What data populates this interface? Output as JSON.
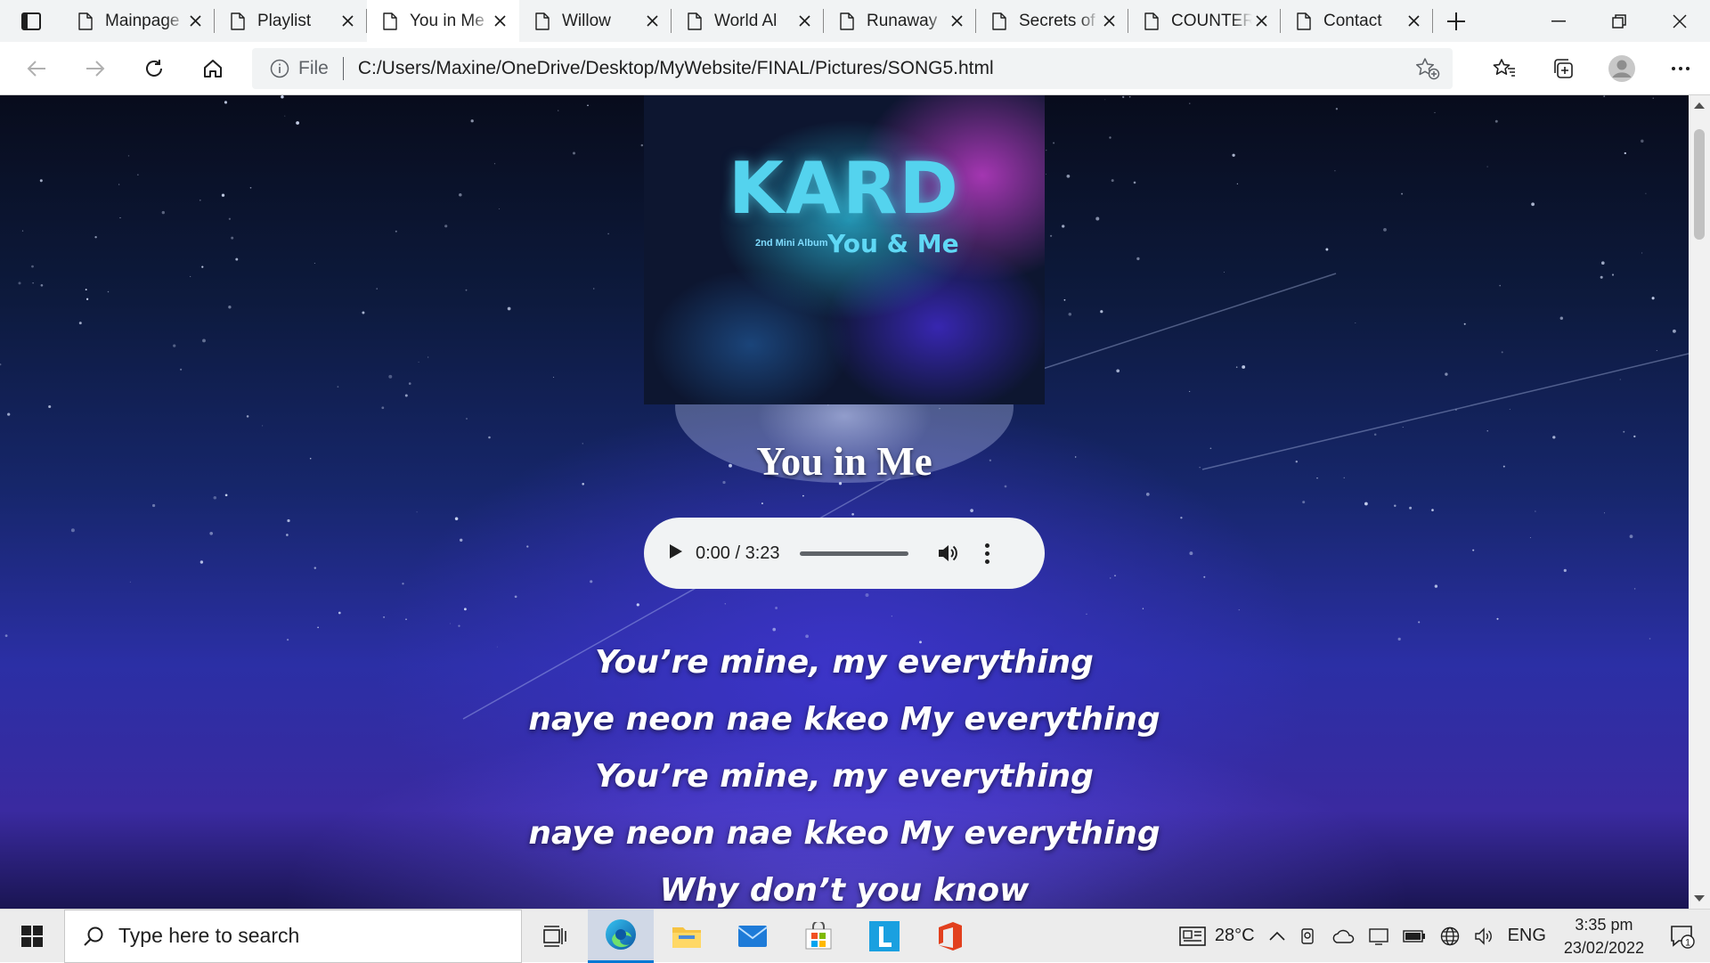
{
  "browser": {
    "tabs": [
      {
        "title": "Mainpage",
        "active": false
      },
      {
        "title": "Playlist",
        "active": false
      },
      {
        "title": "You in Me",
        "active": true
      },
      {
        "title": "Willow",
        "active": false
      },
      {
        "title": "World Al",
        "active": false
      },
      {
        "title": "Runaway",
        "active": false
      },
      {
        "title": "Secrets of",
        "active": false
      },
      {
        "title": "COUNTER",
        "active": false
      },
      {
        "title": "Contact",
        "active": false
      }
    ],
    "address": {
      "file_label": "File",
      "url": "C:/Users/Maxine/OneDrive/Desktop/MyWebsite/FINAL/Pictures/SONG5.html"
    }
  },
  "page": {
    "album": {
      "logo": "KARD",
      "subtitle": "2nd Mini Album",
      "album_title": "You & Me"
    },
    "song_title": "You in Me",
    "player": {
      "time": "0:00 / 3:23",
      "progress": 0
    },
    "lyrics": [
      "You’re mine, my everything",
      "naye neon nae kkeo My everything",
      "You’re mine, my everything",
      "naye neon nae kkeo My everything",
      "Why don’t you know"
    ]
  },
  "taskbar": {
    "search_placeholder": "Type here to search",
    "apps": [
      "edge-icon",
      "file-explorer-icon",
      "mail-icon",
      "store-icon",
      "l-app-icon",
      "office-icon"
    ],
    "tray": {
      "weather": "28°C",
      "language": "ENG",
      "time": "3:35 pm",
      "date": "23/02/2022",
      "notification_count": "1"
    }
  },
  "colors": {
    "accent": "#0078d4",
    "tab_strip": "#f1f3f4",
    "player_bg": "#f1f3f4",
    "kard_logo": "#54d3ee"
  }
}
